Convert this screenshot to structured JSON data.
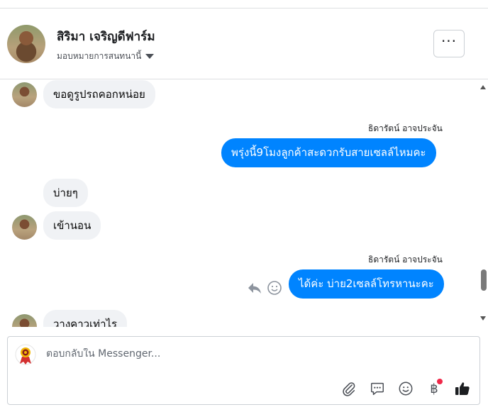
{
  "header": {
    "name": "สิริมา เจริญดีฟาร์ม",
    "assign_label": "มอบหมายการสนทนานี้",
    "more_label": "···"
  },
  "messages": [
    {
      "direction": "in",
      "text": "ขอดูรูปรถคอกหน่อย"
    },
    {
      "direction": "out",
      "sender": "ธิดารัตน์ อาจประจัน",
      "text": "พรุ่งนี้9โมงลูกค้าสะดวกรับสายเซลล์ไหมคะ"
    },
    {
      "direction": "in",
      "text": "บ่ายๆ"
    },
    {
      "direction": "in",
      "text": "เข้านอน"
    },
    {
      "direction": "out",
      "sender": "ธิดารัตน์ อาจประจัน",
      "text": "ได้ค่ะ บ่าย2เซลล์โทรหานะคะ"
    },
    {
      "direction": "in",
      "text": "วางคาวเท่าไร"
    }
  ],
  "composer": {
    "placeholder": "ตอบกลับใน Messenger...",
    "baht_symbol": "฿"
  },
  "icons": {
    "more": "more-horizontal-icon",
    "reply": "reply-icon",
    "react": "smiley-icon",
    "attach": "paperclip-icon",
    "saved_replies": "chat-bubble-icon",
    "emoji": "emoji-icon",
    "payment": "baht-icon",
    "like": "thumbs-up-icon"
  },
  "colors": {
    "outgoing_bubble": "#0084ff",
    "incoming_bubble": "#f0f2f5",
    "notification_dot": "#f02849"
  }
}
